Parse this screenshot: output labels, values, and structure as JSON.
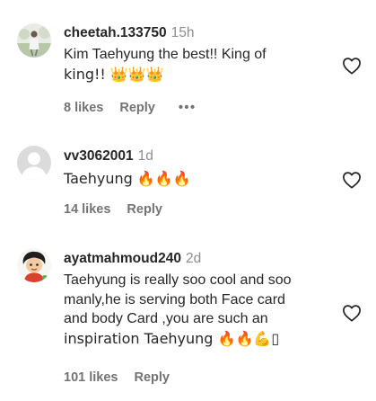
{
  "comments": [
    {
      "username": "cheetah.133750",
      "time": "15h",
      "text_lines": [
        "Kim Taehyung the best!! King of",
        "king!! 👑👑👑"
      ],
      "likes": "8 likes",
      "reply": "Reply",
      "more": "•••",
      "avatar_icon": "profile-photo-figure",
      "heart_icon": "heart-outline-icon"
    },
    {
      "username": "vv3062001",
      "time": "1d",
      "text_lines": [
        "Taehyung 🔥🔥🔥"
      ],
      "likes": "14 likes",
      "reply": "Reply",
      "avatar_icon": "default-avatar-icon",
      "heart_icon": "heart-outline-icon"
    },
    {
      "username": "ayatmahmoud240",
      "time": "2d",
      "text_lines": [
        "Taehyung is really soo cool and soo",
        "manly,he is serving both Face card",
        "and body Card ,you are such an",
        "inspiration Taehyung 🔥🔥💪▯"
      ],
      "likes": "101 likes",
      "reply": "Reply",
      "avatar_icon": "cartoon-character-avatar",
      "heart_icon": "heart-outline-icon"
    }
  ],
  "colors": {
    "text": "#262626",
    "secondary": "#737373",
    "time": "#8e8e8e",
    "default_avatar_bg": "#dbdbdb",
    "default_avatar_fg": "#ffffff"
  }
}
